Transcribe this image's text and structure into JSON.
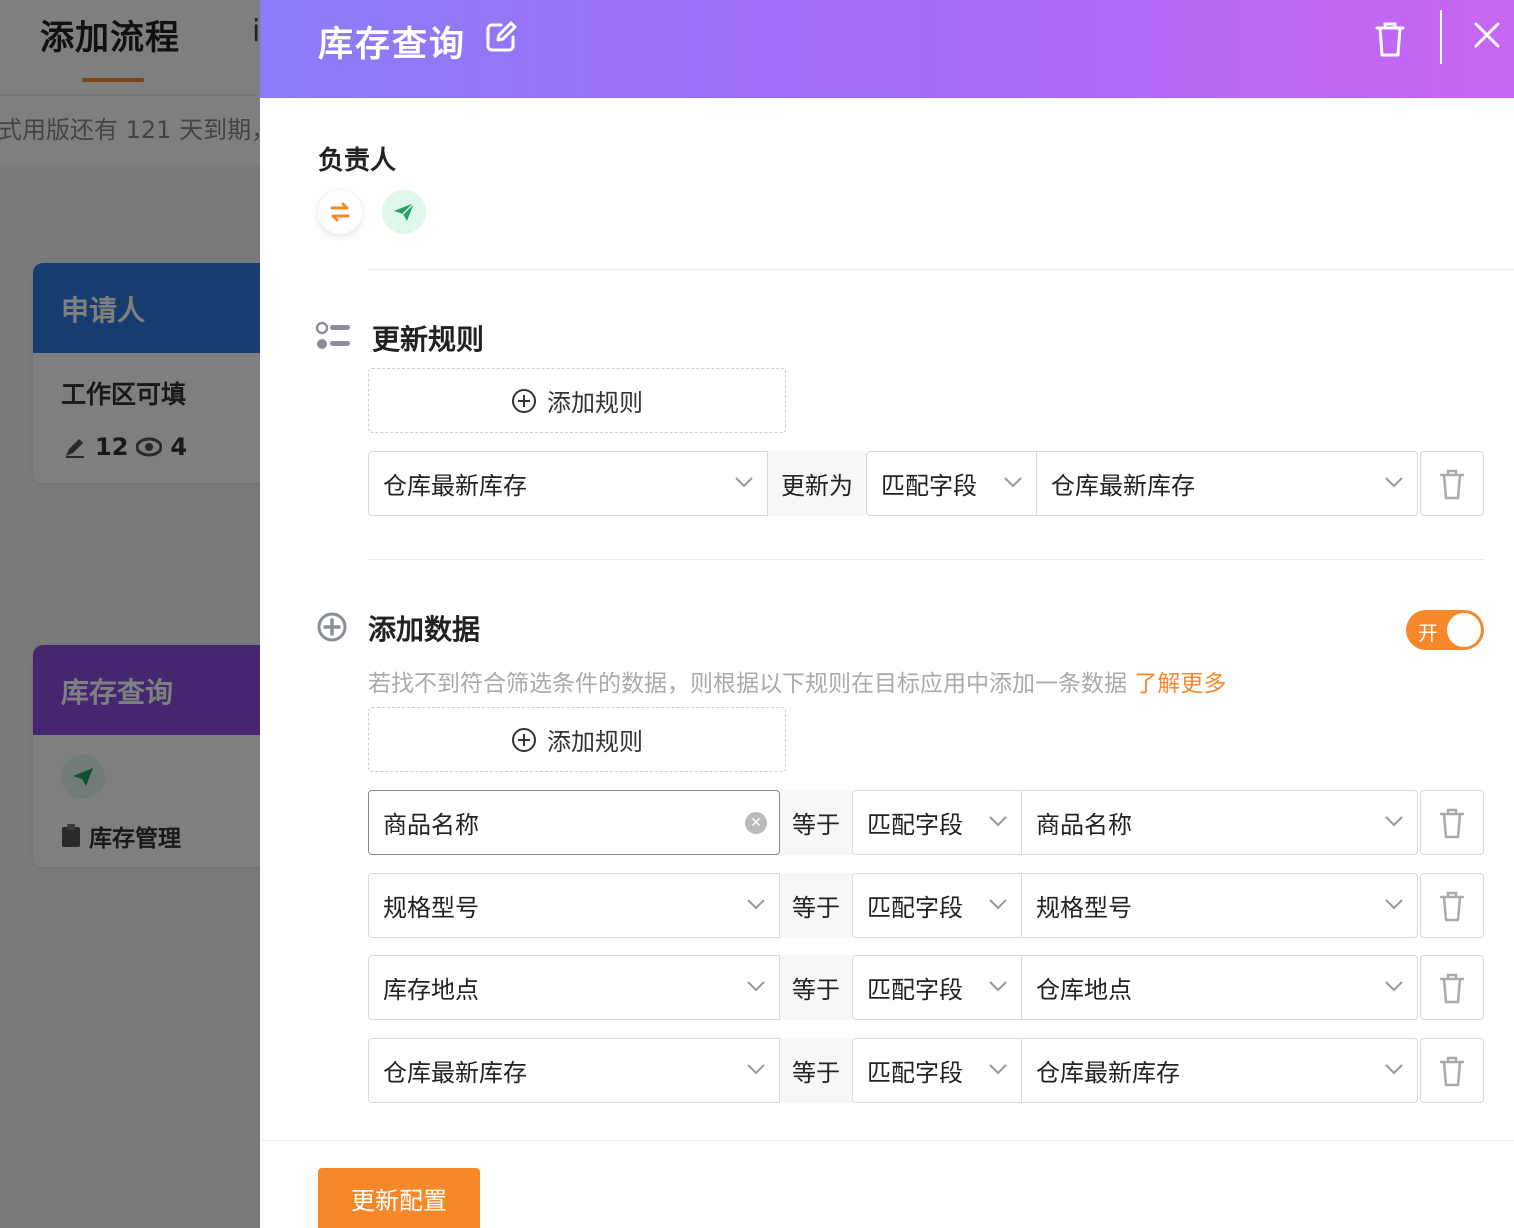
{
  "background": {
    "title": "添加流程",
    "tab2": "i",
    "trial_text": "式用版还有 121 天到期，",
    "card1": {
      "header": "申请人",
      "subtitle": "工作区可填",
      "edit_count": "12",
      "view_count": "4"
    },
    "card2": {
      "header": "库存查询",
      "item": "库存管理"
    }
  },
  "drawer": {
    "title": "库存查询",
    "owner_label": "负责人",
    "update_rules": {
      "title": "更新规则",
      "add_label": "添加规则",
      "row": {
        "field": "仓库最新库存",
        "op": "更新为",
        "type": "匹配字段",
        "target": "仓库最新库存"
      }
    },
    "add_data": {
      "title": "添加数据",
      "toggle_label": "开",
      "toggle_on": true,
      "description": "若找不到符合筛选条件的数据，则根据以下规则在目标应用中添加一条数据",
      "learn_more": "了解更多",
      "add_label": "添加规则",
      "rows": [
        {
          "field": "商品名称",
          "op": "等于",
          "type": "匹配字段",
          "target": "商品名称"
        },
        {
          "field": "规格型号",
          "op": "等于",
          "type": "匹配字段",
          "target": "规格型号"
        },
        {
          "field": "库存地点",
          "op": "等于",
          "type": "匹配字段",
          "target": "仓库地点"
        },
        {
          "field": "仓库最新库存",
          "op": "等于",
          "type": "匹配字段",
          "target": "仓库最新库存"
        }
      ]
    },
    "submit_label": "更新配置"
  },
  "colors": {
    "accent": "#f5892a",
    "header_start": "#8b7cf7",
    "header_end": "#c866f2",
    "card1": "#2f7be0",
    "card2": "#8a4fe0"
  }
}
